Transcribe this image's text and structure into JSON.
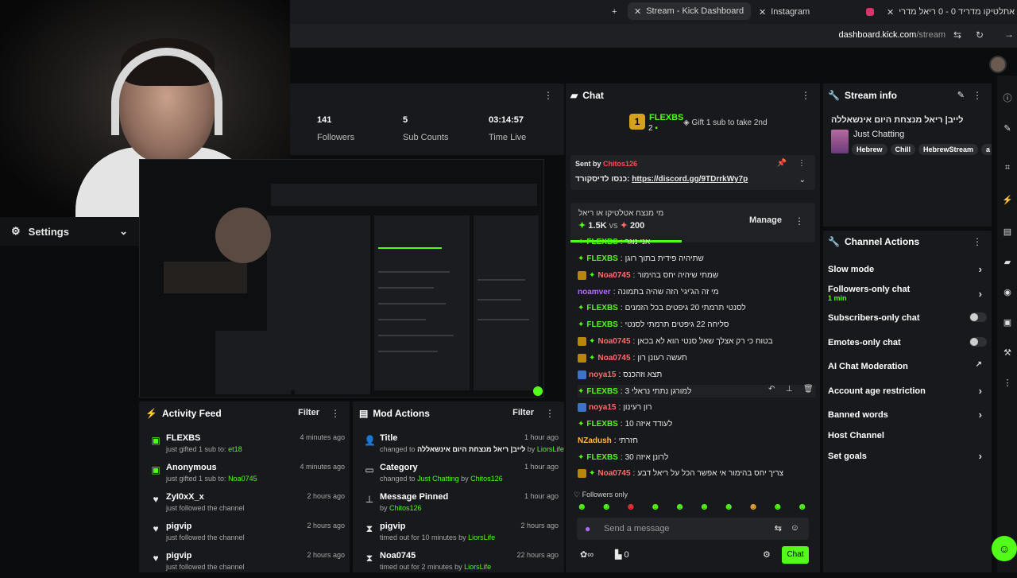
{
  "browser": {
    "tabs": [
      {
        "label": "Stream - Kick Dashboard",
        "active": true
      },
      {
        "label": "Instagram",
        "active": false
      },
      {
        "label": "אתלטיקו מדריד 0 - 0 ריאל מדרי",
        "active": false
      }
    ],
    "new_tab_icon": "plus-icon",
    "url_host": "dashboard.kick.com",
    "url_path": "/stream"
  },
  "settings": {
    "label": "Settings"
  },
  "stats": [
    {
      "value": "141",
      "label": "Followers"
    },
    {
      "value": "5",
      "label": "Sub Counts"
    },
    {
      "value": "03:14:57",
      "label": "Time Live"
    }
  ],
  "chat": {
    "title": "Chat",
    "gifter": {
      "rank": "1",
      "name": "FLEXBS",
      "count": "2",
      "cta": "Gift 1 sub to take 2nd"
    },
    "pinned": {
      "sent_by_label": "Sent by",
      "sender": "Chitos126",
      "text": "כנסו לדיסקורד:",
      "link": "https://discord.gg/9TDrrkWy7p"
    },
    "poll": {
      "question": "מי מנצח אטלטיקו או ריאל",
      "left": "1.5K",
      "vs": "vs",
      "right": "200",
      "manage": "Manage"
    },
    "messages": [
      {
        "user": "FLEXBS",
        "text": "אני נוגר",
        "color": "#53fc18",
        "badge": "none"
      },
      {
        "user": "FLEXBS",
        "text": "שתיהיה פידית בתוך רוגן",
        "color": "#53fc18",
        "badge": "none"
      },
      {
        "user": "Noa0745",
        "text": "שמתי שיהיה יחס בהימור",
        "color": "#ff6b6b",
        "badge": "mod"
      },
      {
        "user": "noamver",
        "text": "מי זה הג'יגי' הזה שהיה בתמונה",
        "color": "#b36bff",
        "badge": "none"
      },
      {
        "user": "FLEXBS",
        "text": "לסנטי תרמתי 20 גיפטים בכל הזמנים",
        "color": "#53fc18",
        "badge": "none"
      },
      {
        "user": "FLEXBS",
        "text": "סליחה 22 גיפטים תרמתי לסנטי",
        "color": "#53fc18",
        "badge": "none"
      },
      {
        "user": "Noa0745",
        "text": "בטוח כי רק אצלך שאל סנטי הוא לא בכאן",
        "color": "#ff6b6b",
        "badge": "mod"
      },
      {
        "user": "Noa0745",
        "text": "תעשה רעונן רון",
        "color": "#ff6b6b",
        "badge": "mod"
      },
      {
        "user": "noya15",
        "text": "תצא וזהכנס",
        "color": "#ff6b6b",
        "badge": "vip"
      },
      {
        "user": "FLEXBS",
        "text": "למורגן נתתי נראלי 3",
        "color": "#53fc18",
        "badge": "none"
      },
      {
        "user": "noya15",
        "text": "רון רעינון",
        "color": "#ff6b6b",
        "badge": "vip"
      },
      {
        "user": "FLEXBS",
        "text": "לעודד איזה 10",
        "color": "#53fc18",
        "badge": "none"
      },
      {
        "user": "NZadush",
        "text": "חזרתי",
        "color": "#ffb84d",
        "badge": "none"
      },
      {
        "user": "FLEXBS",
        "text": "לרונן איזה 30",
        "color": "#53fc18",
        "badge": "none"
      },
      {
        "user": "Noa0745",
        "text": "צריך יחס בהימור אי אפשר הכל על ריאל דבע",
        "color": "#ff6b6b",
        "badge": "mod"
      }
    ],
    "followers_only": "Followers only",
    "input_placeholder": "Send a message",
    "viewer_count": "0",
    "send_label": "Chat"
  },
  "stream_info": {
    "title_label": "Stream info",
    "stream_title": "לייב| ריאל מנצחת היום אינשאללה",
    "category": "Just Chatting",
    "tags": [
      "Hebrew",
      "Chill",
      "HebrewStream",
      "a"
    ]
  },
  "channel_actions": {
    "title": "Channel Actions",
    "items": [
      {
        "label": "Slow mode",
        "control": "chevron"
      },
      {
        "label": "Followers-only chat",
        "sub": "1 min",
        "control": "chevron"
      },
      {
        "label": "Subscribers-only chat",
        "control": "toggle-off"
      },
      {
        "label": "Emotes-only chat",
        "control": "toggle-off"
      },
      {
        "label": "AI Chat Moderation",
        "control": "external"
      },
      {
        "label": "Account age restriction",
        "control": "chevron"
      },
      {
        "label": "Banned words",
        "control": "chevron"
      },
      {
        "label": "Host Channel",
        "control": "none"
      },
      {
        "label": "Set goals",
        "control": "chevron"
      }
    ]
  },
  "activity_feed": {
    "title": "Activity Feed",
    "filter": "Filter",
    "items": [
      {
        "name": "FLEXBS",
        "action": "just gifted 1 sub to:",
        "target": "et18",
        "time": "4 minutes ago",
        "icon": "gift-icon"
      },
      {
        "name": "Anonymous",
        "action": "just gifted 1 sub to:",
        "target": "Noa0745",
        "time": "4 minutes ago",
        "icon": "gift-icon"
      },
      {
        "name": "ZyI0xX_x",
        "action": "just followed the channel",
        "target": "",
        "time": "2 hours ago",
        "icon": "heart-icon"
      },
      {
        "name": "pigvip",
        "action": "just followed the channel",
        "target": "",
        "time": "2 hours ago",
        "icon": "heart-icon"
      },
      {
        "name": "pigvip",
        "action": "just followed the channel",
        "target": "",
        "time": "2 hours ago",
        "icon": "heart-icon"
      }
    ]
  },
  "mod_actions": {
    "title": "Mod Actions",
    "filter": "Filter",
    "items": [
      {
        "name": "Title",
        "detail": "changed to",
        "value": "לייב| ריאל מנצחת היום אינשאללה",
        "by": "by",
        "actor": "LiorsLife",
        "time": "1 hour ago",
        "icon": "title-icon"
      },
      {
        "name": "Category",
        "detail": "changed to",
        "value": "Just Chatting",
        "by": "by",
        "actor": "Chitos126",
        "time": "1 hour ago",
        "icon": "category-icon"
      },
      {
        "name": "Message Pinned",
        "detail": "",
        "value": "",
        "by": "by",
        "actor": "Chitos126",
        "time": "1 hour ago",
        "icon": "pin-icon"
      },
      {
        "name": "pigvip",
        "detail": "timed out for 10 minutes",
        "value": "",
        "by": "by",
        "actor": "LiorsLife",
        "time": "2 hours ago",
        "icon": "hourglass-icon"
      },
      {
        "name": "Noa0745",
        "detail": "timed out for 2 minutes",
        "value": "",
        "by": "by",
        "actor": "LiorsLife",
        "time": "22 hours ago",
        "icon": "hourglass-icon"
      }
    ]
  },
  "colors": {
    "accent": "#53fc18",
    "panel": "#18191c",
    "background": "#0b0c0d"
  }
}
